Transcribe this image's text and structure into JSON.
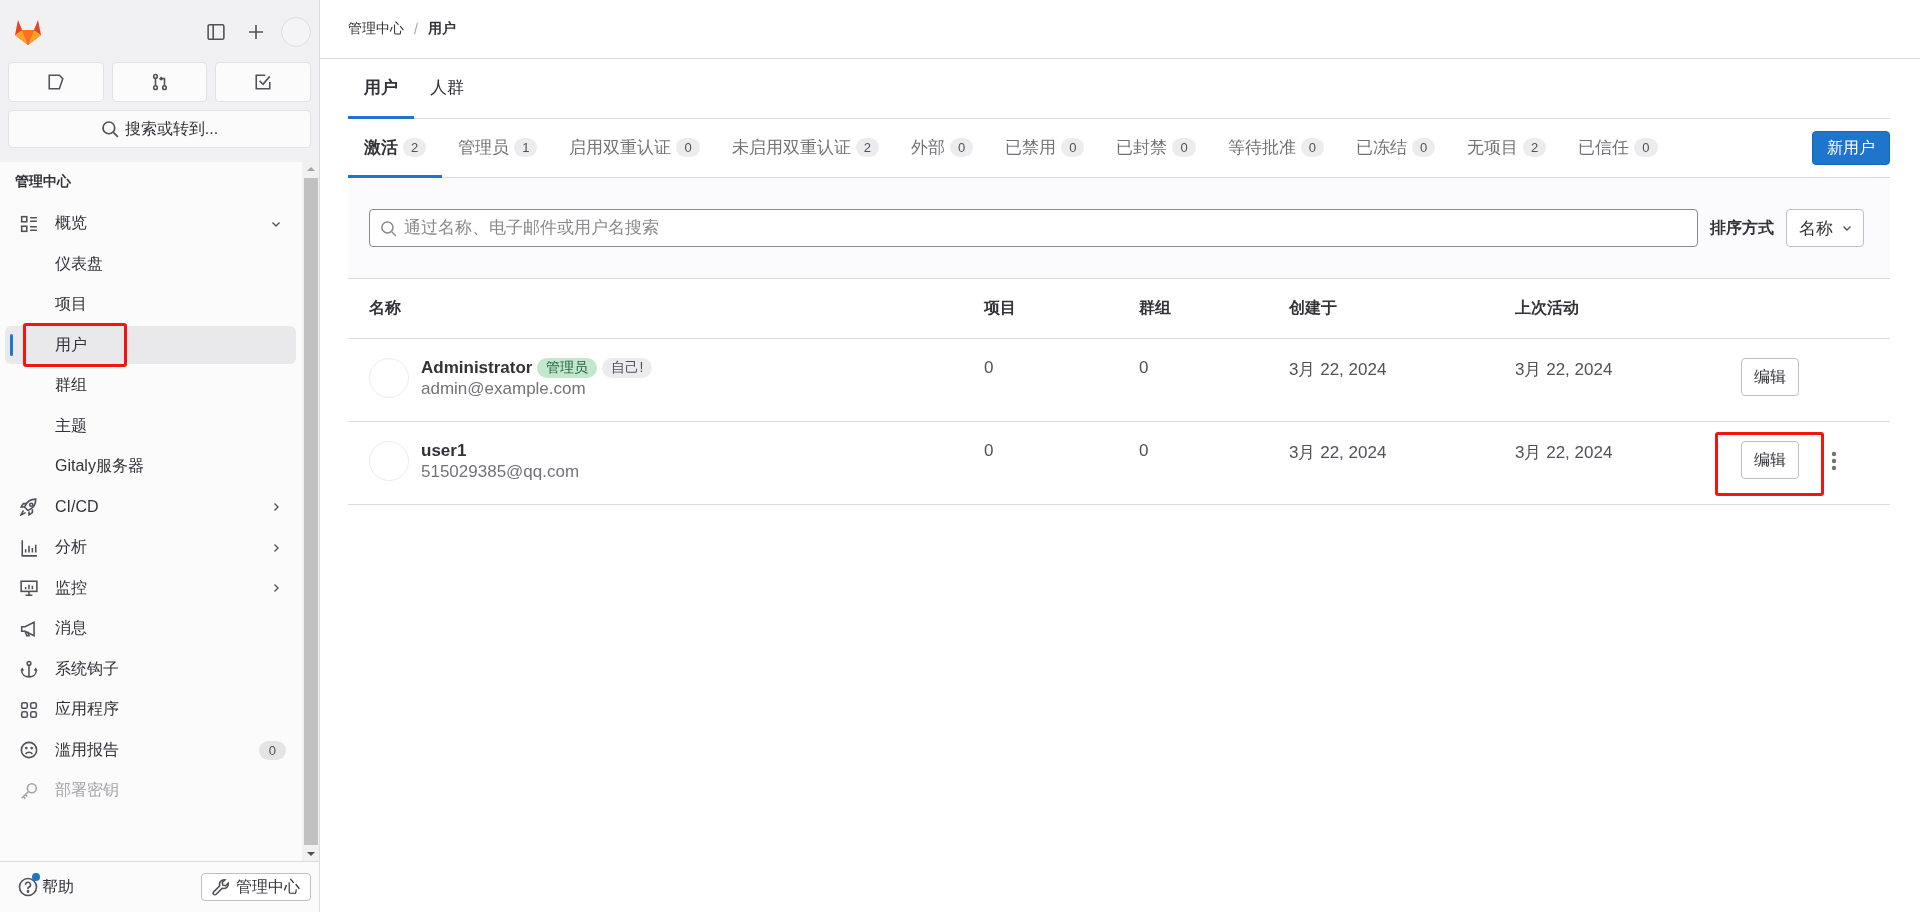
{
  "sidebar": {
    "search_button": "搜索或转到...",
    "section_title": "管理中心",
    "items": [
      {
        "kind": "group",
        "label": "概览",
        "expanded": true,
        "disabled": false,
        "children": [
          {
            "label": "仪表盘",
            "selected": false,
            "highlighted": false
          },
          {
            "label": "项目",
            "selected": false,
            "highlighted": false
          },
          {
            "label": "用户",
            "selected": true,
            "highlighted": true
          },
          {
            "label": "群组",
            "selected": false,
            "highlighted": false
          },
          {
            "label": "主题",
            "selected": false,
            "highlighted": false
          },
          {
            "label": "Gitaly服务器",
            "selected": false,
            "highlighted": false
          }
        ]
      },
      {
        "kind": "group",
        "label": "CI/CD",
        "expanded": false,
        "disabled": false
      },
      {
        "kind": "group",
        "label": "分析",
        "expanded": false,
        "disabled": false
      },
      {
        "kind": "group",
        "label": "监控",
        "expanded": false,
        "disabled": false
      },
      {
        "kind": "link",
        "label": "消息",
        "disabled": false
      },
      {
        "kind": "link",
        "label": "系统钩子",
        "disabled": false
      },
      {
        "kind": "link",
        "label": "应用程序",
        "disabled": false
      },
      {
        "kind": "link",
        "label": "滥用报告",
        "count": "0",
        "disabled": false
      },
      {
        "kind": "link",
        "label": "部署密钥",
        "disabled": true
      }
    ],
    "footer": {
      "help": "帮助",
      "help_notification": true,
      "admin_button": "管理中心"
    }
  },
  "breadcrumb": {
    "items": [
      "管理中心",
      "用户"
    ],
    "separator": "/"
  },
  "tabs": [
    {
      "label": "用户",
      "selected": true
    },
    {
      "label": "人群",
      "selected": false
    }
  ],
  "filters": [
    {
      "label": "激活",
      "count": "2",
      "selected": true
    },
    {
      "label": "管理员",
      "count": "1",
      "selected": false
    },
    {
      "label": "启用双重认证",
      "count": "0",
      "selected": false
    },
    {
      "label": "未启用双重认证",
      "count": "2",
      "selected": false
    },
    {
      "label": "外部",
      "count": "0",
      "selected": false
    },
    {
      "label": "已禁用",
      "count": "0",
      "selected": false
    },
    {
      "label": "已封禁",
      "count": "0",
      "selected": false
    },
    {
      "label": "等待批准",
      "count": "0",
      "selected": false
    },
    {
      "label": "已冻结",
      "count": "0",
      "selected": false
    },
    {
      "label": "无项目",
      "count": "2",
      "selected": false
    },
    {
      "label": "已信任",
      "count": "0",
      "selected": false
    }
  ],
  "new_user_button": "新用户",
  "search": {
    "placeholder": "通过名称、电子邮件或用户名搜索"
  },
  "sort": {
    "label": "排序方式",
    "value": "名称"
  },
  "table": {
    "columns": [
      "名称",
      "项目",
      "群组",
      "创建于",
      "上次活动"
    ],
    "rows": [
      {
        "name": "Administrator",
        "badges": [
          {
            "label": "管理员",
            "kind": "admin"
          },
          {
            "label": "自己!",
            "kind": "self"
          }
        ],
        "email": "admin@example.com",
        "projects": "0",
        "groups": "0",
        "created": "3月 22, 2024",
        "last_activity": "3月 22, 2024",
        "action": "编辑",
        "more_menu": false,
        "highlighted": false
      },
      {
        "name": "user1",
        "badges": [],
        "email": "515029385@qq.com",
        "projects": "0",
        "groups": "0",
        "created": "3月 22, 2024",
        "last_activity": "3月 22, 2024",
        "action": "编辑",
        "more_menu": true,
        "highlighted": true
      }
    ]
  }
}
